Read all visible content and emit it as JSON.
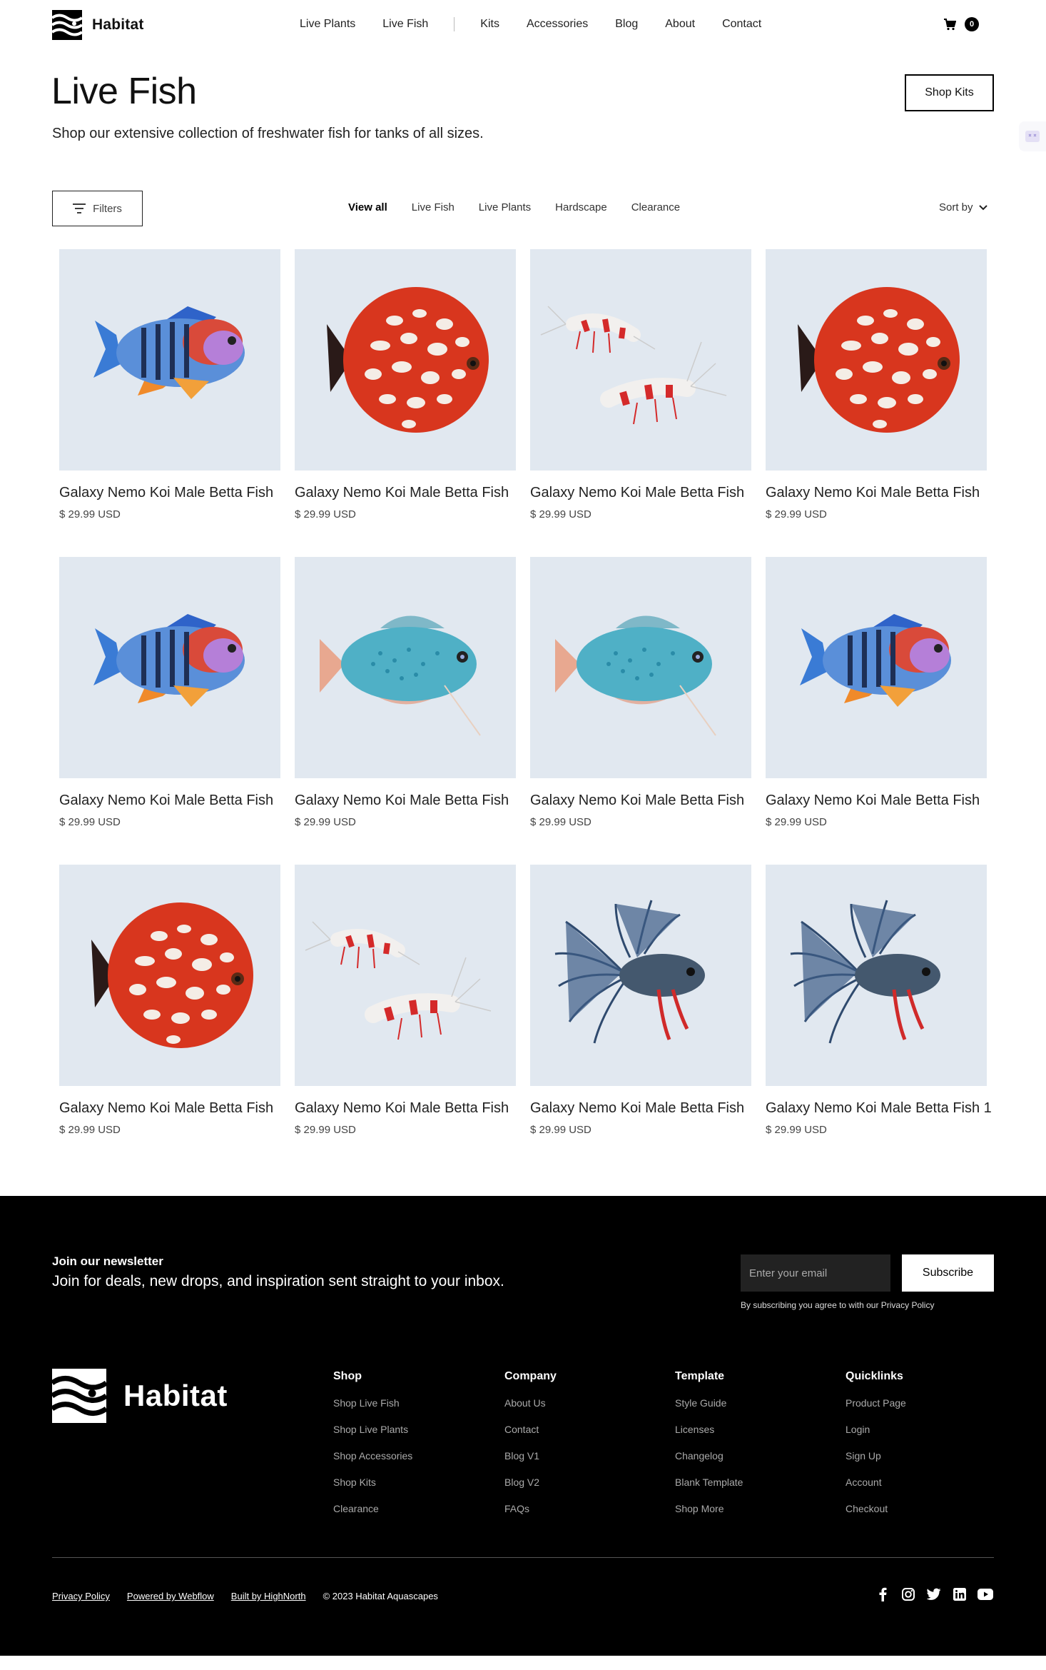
{
  "nav": {
    "brand": "Habitat",
    "links": [
      "Live Plants",
      "Live Fish",
      "Kits",
      "Accessories",
      "Blog",
      "About",
      "Contact"
    ],
    "cart_count": "0"
  },
  "header": {
    "title": "Live Fish",
    "subtitle": "Shop our extensive collection of freshwater fish for tanks of all sizes.",
    "shop_kits": "Shop Kits"
  },
  "filters": {
    "button": "Filters",
    "tabs": [
      "View all",
      "Live Fish",
      "Live Plants",
      "Hardscape",
      "Clearance"
    ],
    "sort": "Sort by"
  },
  "products": [
    {
      "title": "Galaxy Nemo Koi Male Betta Fish",
      "price": "$ 29.99 USD",
      "image": "blue-cichlid"
    },
    {
      "title": "Galaxy Nemo Koi Male Betta Fish",
      "price": "$ 29.99 USD",
      "image": "red-discus"
    },
    {
      "title": "Galaxy Nemo Koi Male Betta Fish",
      "price": "$ 29.99 USD",
      "image": "red-shrimp"
    },
    {
      "title": "Galaxy Nemo Koi Male Betta Fish",
      "price": "$ 29.99 USD",
      "image": "red-discus"
    },
    {
      "title": "Galaxy Nemo Koi Male Betta Fish",
      "price": "$ 29.99 USD",
      "image": "blue-cichlid"
    },
    {
      "title": "Galaxy Nemo Koi Male Betta Fish",
      "price": "$ 29.99 USD",
      "image": "blue-gourami"
    },
    {
      "title": "Galaxy Nemo Koi Male Betta Fish",
      "price": "$ 29.99 USD",
      "image": "blue-gourami"
    },
    {
      "title": "Galaxy Nemo Koi Male Betta Fish",
      "price": "$ 29.99 USD",
      "image": "blue-cichlid"
    },
    {
      "title": "Galaxy Nemo Koi Male Betta Fish",
      "price": "$ 29.99 USD",
      "image": "red-discus"
    },
    {
      "title": "Galaxy Nemo Koi Male Betta Fish",
      "price": "$ 29.99 USD",
      "image": "red-shrimp"
    },
    {
      "title": "Galaxy Nemo Koi Male Betta Fish",
      "price": "$ 29.99 USD",
      "image": "blue-betta"
    },
    {
      "title": "Galaxy Nemo Koi Male Betta Fish 1",
      "price": "$ 29.99 USD",
      "image": "blue-betta"
    }
  ],
  "footer": {
    "newsletter_title": "Join our newsletter",
    "newsletter_sub": "Join for deals, new drops, and inspiration sent straight to your inbox.",
    "email_placeholder": "Enter your email",
    "subscribe": "Subscribe",
    "note": "By subscribing you agree to with our Privacy Policy",
    "brand": "Habitat",
    "columns": [
      {
        "heading": "Shop",
        "items": [
          "Shop Live Fish",
          "Shop Live Plants",
          "Shop Accessories",
          "Shop Kits",
          "Clearance"
        ]
      },
      {
        "heading": "Company",
        "items": [
          "About Us",
          "Contact",
          "Blog V1",
          "Blog V2",
          "FAQs"
        ]
      },
      {
        "heading": "Template",
        "items": [
          "Style Guide",
          "Licenses",
          "Changelog",
          "Blank Template",
          "Shop More"
        ]
      },
      {
        "heading": "Quicklinks",
        "items": [
          "Product Page",
          "Login",
          "Sign Up",
          "Account",
          "Checkout"
        ]
      }
    ],
    "bottom_links": [
      "Privacy Policy",
      "Powered by Webflow",
      "Built by HighNorth"
    ],
    "copyright": "© 2023 Habitat Aquascapes",
    "social": [
      "facebook-icon",
      "instagram-icon",
      "twitter-icon",
      "linkedin-icon",
      "youtube-icon"
    ]
  }
}
